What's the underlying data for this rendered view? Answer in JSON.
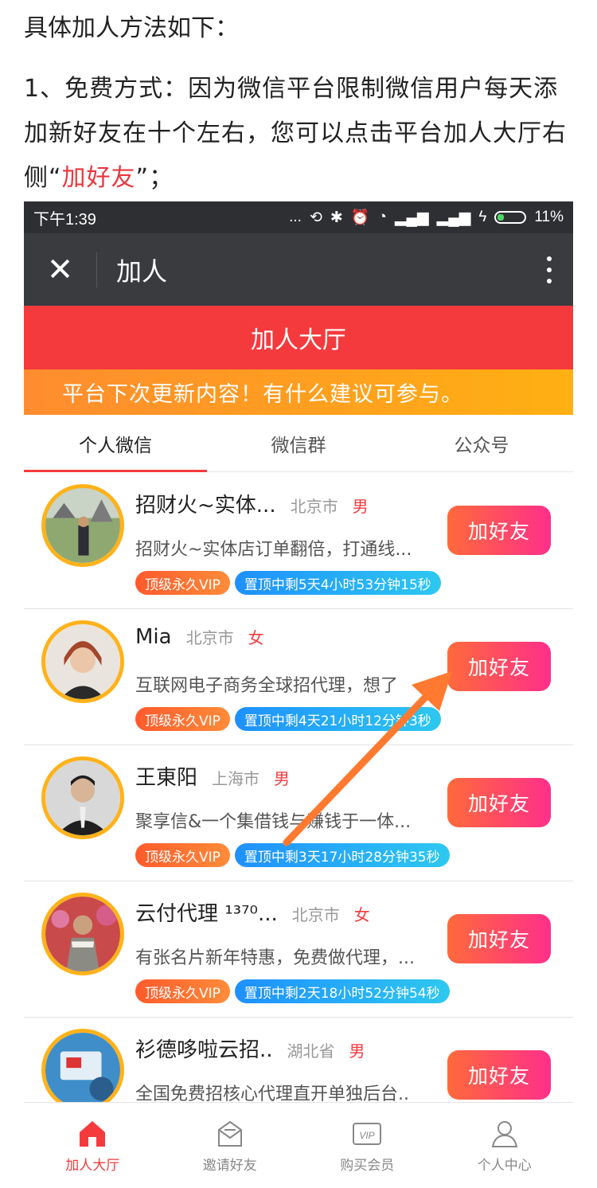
{
  "article": {
    "heading": "具体加人方法如下：",
    "para_prefix": "1、免费方式：因为微信平台限制微信用户每天添加新好友在十个左右，您可以点击平台加人大厅右侧“",
    "para_highlight": "加好友",
    "para_suffix": "”；"
  },
  "status_bar": {
    "time": "下午1:39",
    "dots": "...",
    "battery": "11%"
  },
  "nav": {
    "close_symbol": "✕",
    "title": "加人"
  },
  "banner": {
    "title": "加人大厅"
  },
  "notice": {
    "text": "平台下次更新内容！有什么建议可参与。"
  },
  "tabs": [
    {
      "label": "个人微信",
      "active": true
    },
    {
      "label": "微信群",
      "active": false
    },
    {
      "label": "公众号",
      "active": false
    }
  ],
  "list": [
    {
      "name": "招财火~实体...",
      "city": "北京市",
      "gender": "男",
      "desc": "招财火~实体店订单翻倍，打通线...",
      "vip": "顶级永久VIP",
      "top": "置顶中剩5天4小时53分钟15秒",
      "button": "加好友"
    },
    {
      "name": "Mia",
      "city": "北京市",
      "gender": "女",
      "desc": "互联网电子商务全球招代理，想了",
      "vip": "顶级永久VIP",
      "top": "置顶中剩4天21小时12分钟3秒",
      "button": "加好友"
    },
    {
      "name": "王東阳",
      "city": "上海市",
      "gender": "男",
      "desc": "聚享信&一个集借钱与赚钱于一体...",
      "vip": "顶级永久VIP",
      "top": "置顶中剩3天17小时28分钟35秒",
      "button": "加好友"
    },
    {
      "name": "云付代理 ¹³⁷⁰...",
      "city": "北京市",
      "gender": "女",
      "desc": "有张名片新年特惠，免费做代理，...",
      "vip": "顶级永久VIP",
      "top": "置顶中剩2天18小时52分钟54秒",
      "button": "加好友"
    },
    {
      "name": "衫德哆啦云招..",
      "city": "湖北省",
      "gender": "男",
      "desc": "全国免费招核心代理直开单独后台..",
      "vip": "",
      "top": "",
      "button": "加好友"
    }
  ],
  "bottom_nav": [
    {
      "label": "加人大厅",
      "icon": "home-icon",
      "active": true
    },
    {
      "label": "邀请好友",
      "icon": "invite-mail-icon",
      "active": false
    },
    {
      "label": "购买会员",
      "icon": "vip-ticket-icon",
      "active": false
    },
    {
      "label": "个人中心",
      "icon": "user-icon",
      "active": false
    }
  ],
  "colors": {
    "brand_red": "#f53a3d",
    "notice_orange": "#ffa01e",
    "button_gradient_start": "#ff6a3b",
    "button_gradient_end": "#ff2f8a",
    "avatar_ring": "#ffb21a",
    "arrow_orange": "#ff7a30"
  }
}
